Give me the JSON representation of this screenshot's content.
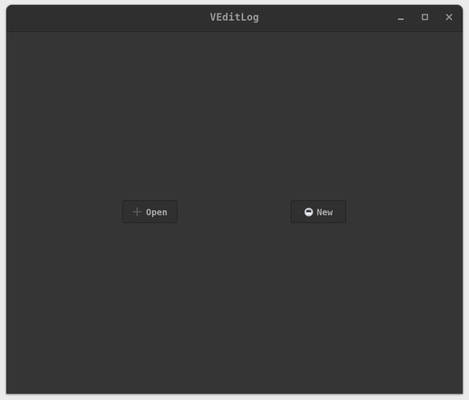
{
  "window": {
    "title": "VEditLog",
    "controls": {
      "minimize_icon": "minimize-icon",
      "maximize_icon": "maximize-icon",
      "close_icon": "close-icon"
    }
  },
  "main": {
    "buttons": {
      "open": {
        "label": "Open",
        "icon": "plus-icon"
      },
      "new": {
        "label": "New",
        "icon": "save-icon"
      }
    }
  },
  "colors": {
    "window_bg": "#353535",
    "titlebar_bg": "#2f2f2f",
    "button_bg": "#303030",
    "text": "#a8a8a8"
  }
}
